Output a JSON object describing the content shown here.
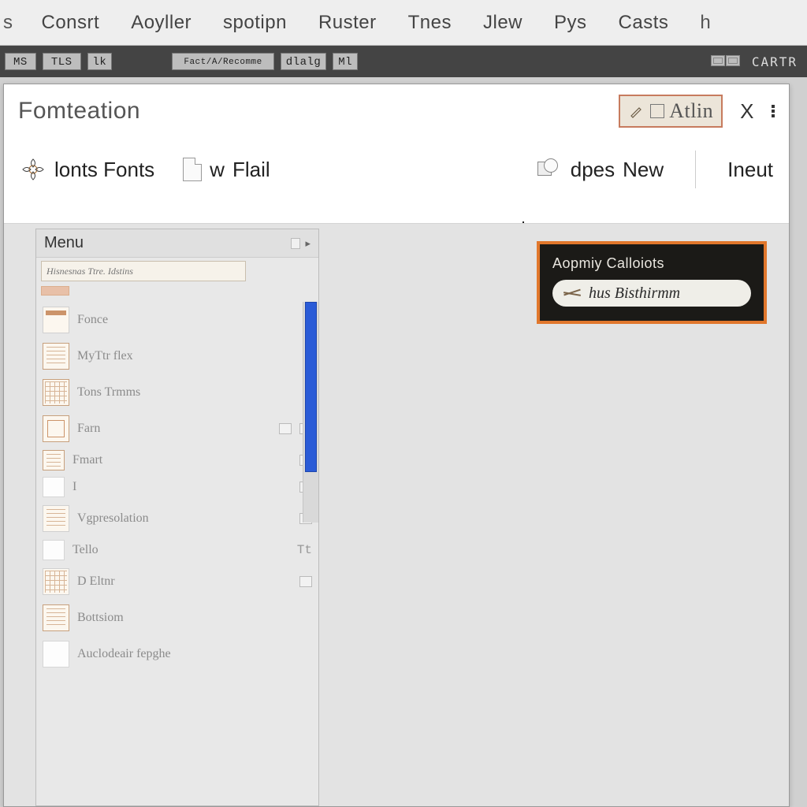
{
  "menubar": {
    "leading": "s",
    "items": [
      "Consrt",
      "Aoyller",
      "spotipn",
      "Ruster",
      "Tnes",
      "Jlew",
      "Pys",
      "Casts"
    ],
    "trailing": "h"
  },
  "toolbar": {
    "btn_ms": "MS",
    "btn_tls": "TLS",
    "btn_lk": "lk",
    "btn_rec": "Fact/A/Recomme",
    "btn_dlg": "dlalg",
    "btn_ml": "Ml",
    "btn_cart": "CARTR"
  },
  "window": {
    "title": "Fomteation",
    "atlin": "Atlin",
    "close": "X"
  },
  "ribbon": {
    "g1": "lonts Fonts",
    "g2a": "w",
    "g2b": "Flail",
    "g3a": "dpes",
    "g3b": "New",
    "g3c": "Ineut"
  },
  "panel": {
    "title": "Menu",
    "search_placeholder": "Hisnesnas Ttre. Idstins",
    "items": [
      {
        "name": "Fonce"
      },
      {
        "name": "MyTtr flex"
      },
      {
        "name": "Tons Trmms"
      },
      {
        "name": "Farn"
      },
      {
        "name": "Fmart"
      },
      {
        "name": "I"
      },
      {
        "name": "Vgpresolation"
      },
      {
        "name": "Tello"
      },
      {
        "name": "D Eltnr"
      },
      {
        "name": "Bottsiom"
      },
      {
        "name": "Auclodeair fepghe"
      }
    ]
  },
  "callout": {
    "title": "Aopmiy Calloiots",
    "text": "hus Bisthirmm"
  }
}
